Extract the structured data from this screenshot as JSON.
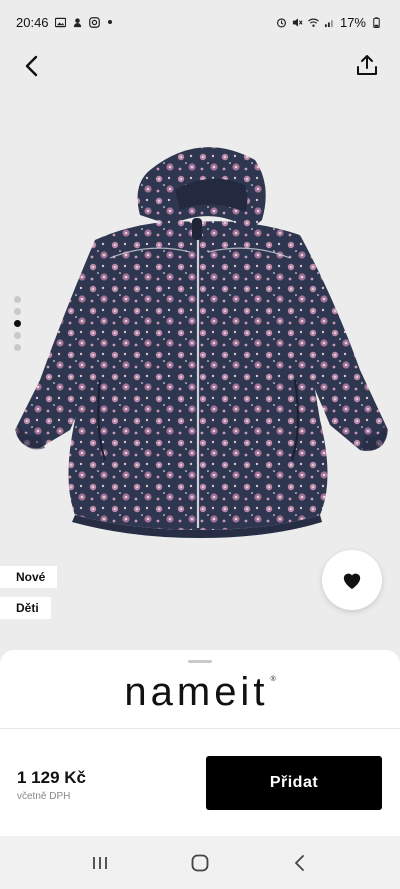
{
  "status_bar": {
    "time": "20:46",
    "battery": "17%",
    "icons": [
      "image-icon",
      "notification-icon",
      "instagram-icon",
      "alarm-icon",
      "mute-icon",
      "wifi-icon",
      "signal-icon",
      "battery-icon"
    ]
  },
  "topbar": {
    "back_icon": "chevron-left-icon",
    "share_icon": "share-icon"
  },
  "product": {
    "image_description_icon": "floral-softshell-jacket",
    "pager": {
      "count": 5,
      "active_index": 2
    },
    "tags": [
      "Nové",
      "Děti"
    ],
    "favorite_icon": "heart-icon"
  },
  "sheet": {
    "brand": "nameit",
    "brand_mark": "®",
    "price": "1 129 Kč",
    "vat_note": "včetně DPH",
    "add_button": "Přidat"
  },
  "navbar": {
    "icons": [
      "recent-apps-icon",
      "home-icon",
      "back-icon"
    ]
  },
  "colors": {
    "background": "#ececec",
    "accent": "#000000",
    "jacket_base": "#2f3650",
    "flower": "#b88aa8"
  }
}
